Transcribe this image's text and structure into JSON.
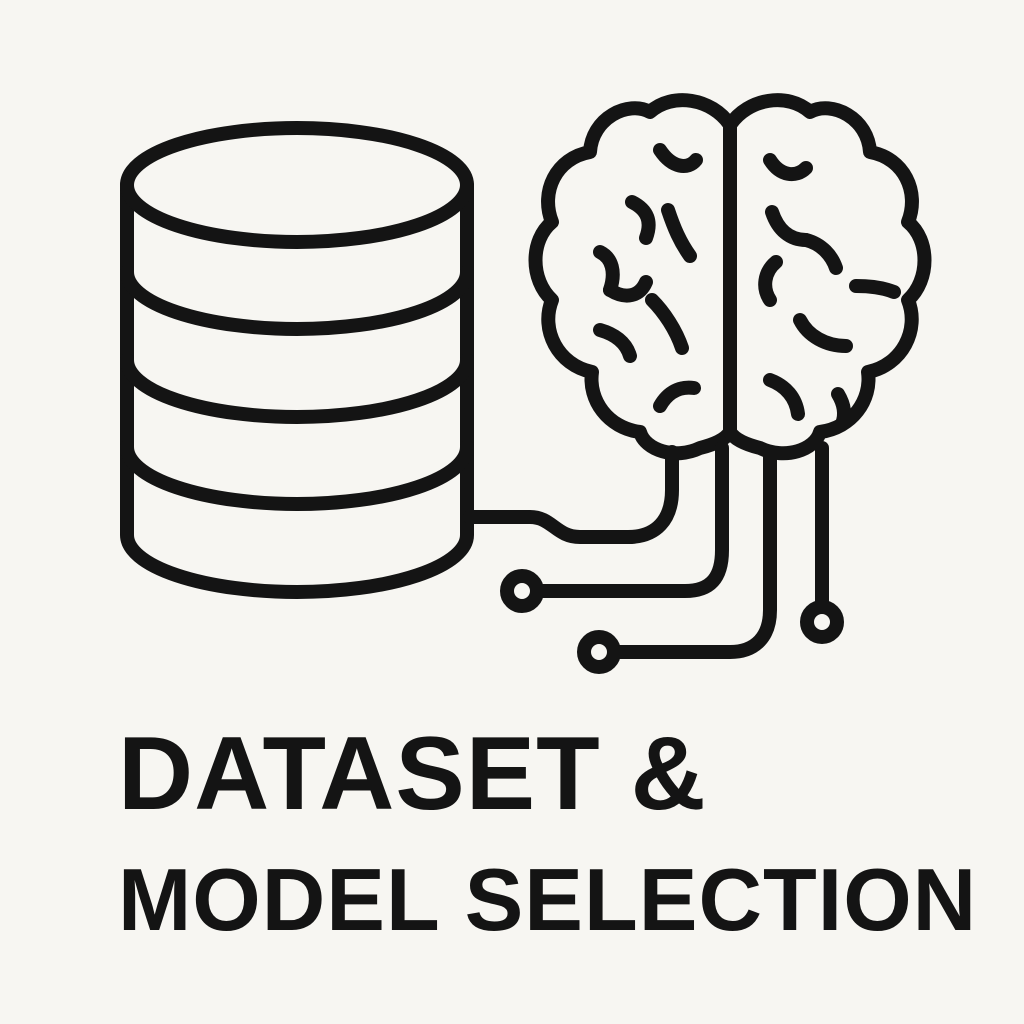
{
  "title": {
    "line1": "DATASET &",
    "line2": "MODEL SELECTION"
  },
  "icons": {
    "dataset": "database-icon",
    "model": "brain-icon",
    "connector": "circuit-connector-icon"
  },
  "colors": {
    "background": "#f7f6f2",
    "ink": "#141414"
  }
}
